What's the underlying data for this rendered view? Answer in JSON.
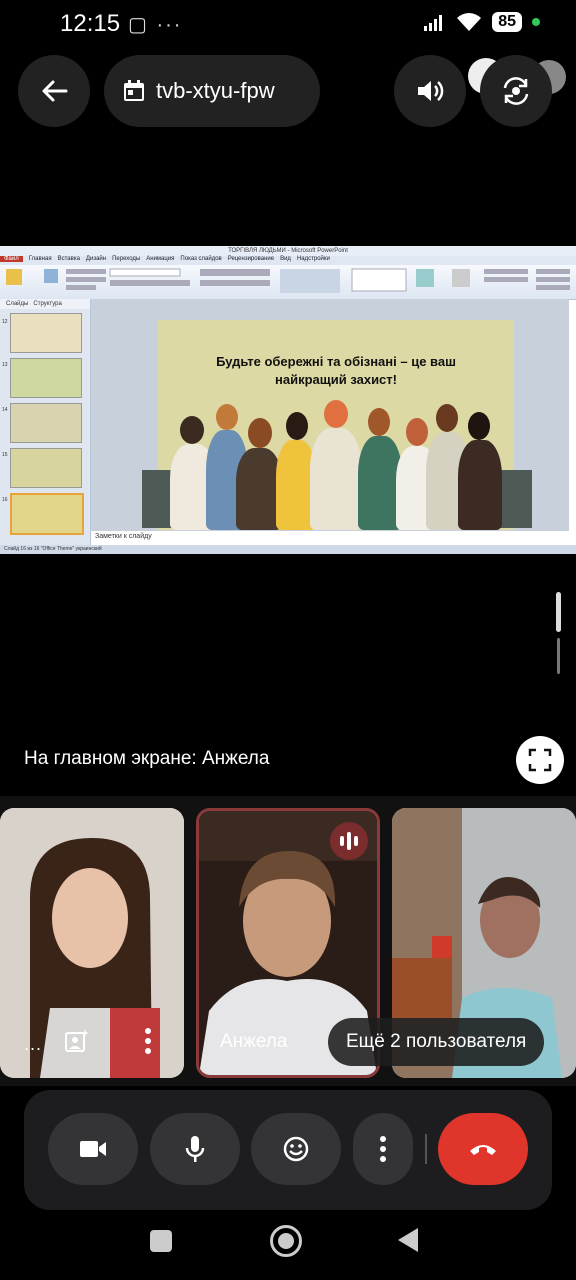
{
  "status_bar": {
    "time": "12:15",
    "left_icons": "▢ ···",
    "battery": "85"
  },
  "meeting": {
    "code": "tvb-xtyu-fpw"
  },
  "presentation": {
    "window_title": "ТОРГІВЛЯ ЛЮДЬМИ - Microsoft PowerPoint",
    "tabs": [
      "Файл",
      "Главная",
      "Вставка",
      "Дизайн",
      "Переходы",
      "Анимация",
      "Показ слайдов",
      "Рецензирование",
      "Вид",
      "Надстройки"
    ],
    "sidebar_tabs": [
      "Слайды",
      "Структура"
    ],
    "thumb_numbers": [
      "12",
      "13",
      "14",
      "15",
      "16"
    ],
    "slide_text": "Будьте обережні та обізнані – це ваш найкращий захист!",
    "notes_placeholder": "Заметки к слайду",
    "status_text": "Слайд 16 из 16   \"Office Theme\"   украинский"
  },
  "main_label": "На главном экране: Анжела",
  "participants": {
    "tile2_name": "Анжела",
    "more_users": "Ещё 2 пользователя",
    "dots": "..."
  },
  "icons": {
    "back": "back-arrow-icon",
    "calendar": "calendar-icon",
    "volume": "volume-icon",
    "switch_camera": "switch-camera-icon",
    "fullscreen": "fullscreen-icon",
    "camera": "camera-icon",
    "mic": "mic-icon",
    "emoji": "emoji-icon",
    "more": "more-vert-icon",
    "end_call": "end-call-icon"
  },
  "colors": {
    "end_call": "#e0352b",
    "speaking_border": "#8a3a3a",
    "slide_bg": "#ddd9a4"
  }
}
